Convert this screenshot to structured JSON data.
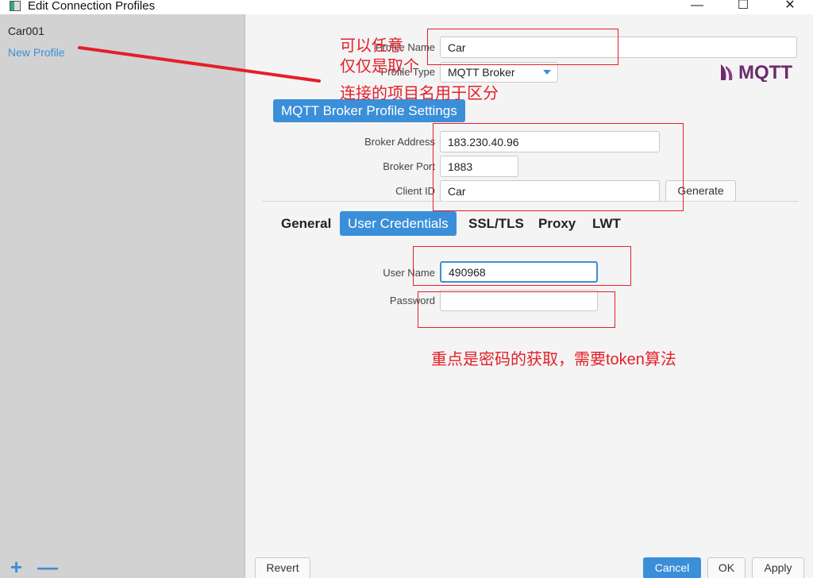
{
  "window": {
    "title": "Edit Connection Profiles",
    "minimize_glyph": "—",
    "maximize_glyph": "☐",
    "close_glyph": "✕"
  },
  "sidebar": {
    "profiles": [
      {
        "label": "Car001"
      },
      {
        "label": "New Profile"
      }
    ],
    "add_label": "+",
    "remove_label": "—"
  },
  "form": {
    "profile_name_label": "Profile Name",
    "profile_name_value": "Car",
    "profile_type_label": "Profile Type",
    "profile_type_value": "MQTT Broker",
    "logo_text": "MQTT",
    "section_title": "MQTT Broker Profile Settings",
    "broker_address_label": "Broker Address",
    "broker_address_value": "183.230.40.96",
    "broker_port_label": "Broker Port",
    "broker_port_value": "1883",
    "client_id_label": "Client ID",
    "client_id_value": "Car",
    "generate_label": "Generate"
  },
  "tabs": [
    {
      "label": "General",
      "active": false
    },
    {
      "label": "User Credentials",
      "active": true
    },
    {
      "label": "SSL/TLS",
      "active": false
    },
    {
      "label": "Proxy",
      "active": false
    },
    {
      "label": "LWT",
      "active": false
    }
  ],
  "credentials": {
    "user_name_label": "User Name",
    "user_name_value": "490968",
    "password_label": "Password",
    "password_value": ""
  },
  "footer": {
    "revert_label": "Revert",
    "cancel_label": "Cancel",
    "ok_label": "OK",
    "apply_label": "Apply"
  },
  "annotations": {
    "note_1_line_1": "可以任意",
    "note_1_line_2": "仅仅是取个",
    "note_1_line_3": "连接的项目名用于区分",
    "note_2": "重点是密码的获取，需要token算法"
  },
  "colors": {
    "accent": "#3b8fd9",
    "annotation": "#e3202a",
    "sidebar_bg": "#d2d2d2"
  }
}
